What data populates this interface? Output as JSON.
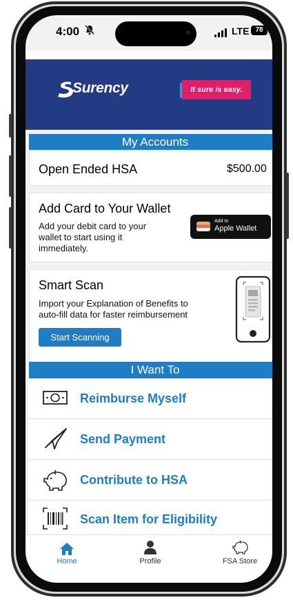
{
  "status_bar": {
    "time": "4:00",
    "network": "LTE",
    "battery": "78"
  },
  "banner": {
    "brand": "Surency",
    "tagline": "It sure is easy."
  },
  "my_accounts": {
    "header": "My Accounts",
    "accounts": [
      {
        "name": "Open Ended HSA",
        "balance": "$500.00"
      }
    ]
  },
  "wallet_card": {
    "title": "Add Card to Your Wallet",
    "description": "Add your debit card to your wallet to start using it immediately.",
    "button_small": "Add to",
    "button_main": "Apple Wallet"
  },
  "smart_scan": {
    "title": "Smart Scan",
    "description": "Import your Explanation of Benefits to auto-fill data for faster reimbursement",
    "button": "Start Scanning"
  },
  "i_want_to": {
    "header": "I Want To",
    "items": [
      {
        "label": "Reimburse Myself",
        "icon": "money-bill-icon"
      },
      {
        "label": "Send Payment",
        "icon": "paper-plane-icon"
      },
      {
        "label": "Contribute to HSA",
        "icon": "piggy-bank-icon"
      },
      {
        "label": "Scan Item for Eligibility",
        "icon": "barcode-icon"
      }
    ]
  },
  "tab_bar": {
    "tabs": [
      {
        "label": "Home",
        "icon": "home-icon",
        "active": true
      },
      {
        "label": "Profile",
        "icon": "person-icon",
        "active": false
      },
      {
        "label": "FSA Store",
        "icon": "piggy-bank-icon",
        "active": false
      }
    ]
  },
  "colors": {
    "brand_navy": "#233a85",
    "accent_blue": "#1e7dc3",
    "tagline_pink": "#e01f6a"
  }
}
